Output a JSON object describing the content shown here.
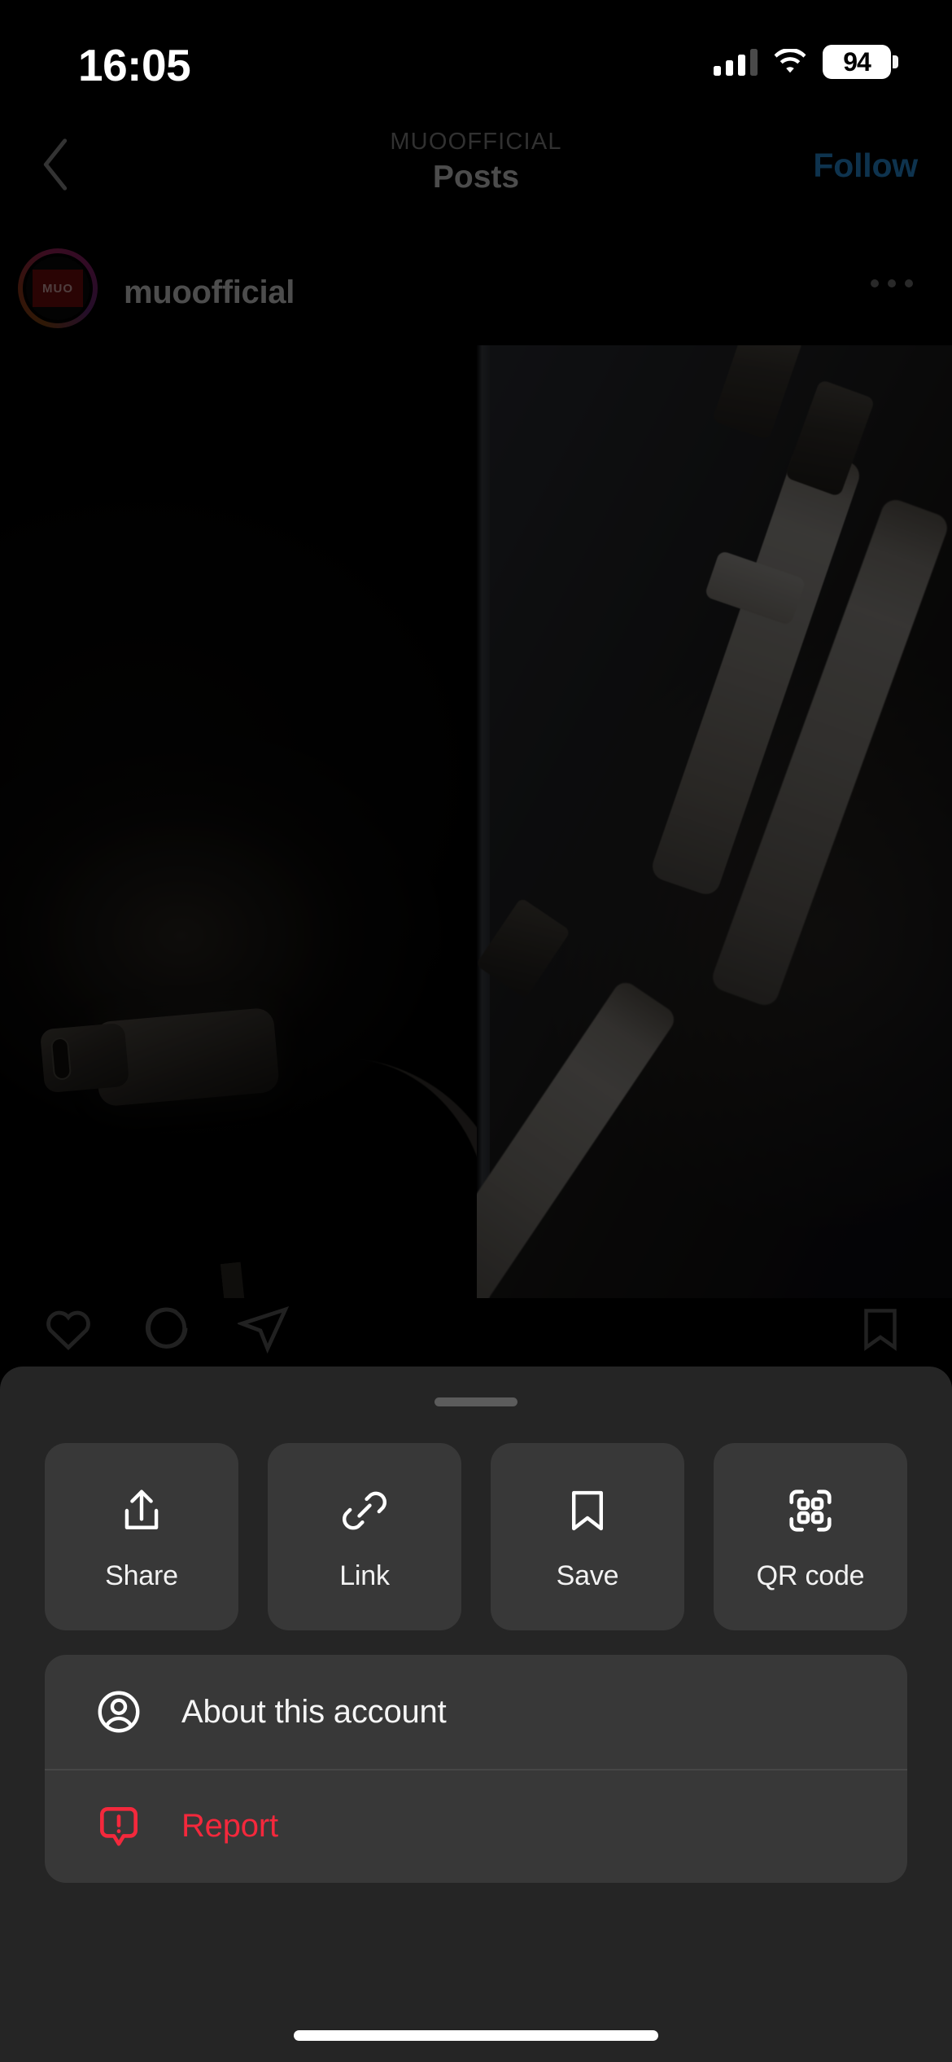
{
  "status_bar": {
    "time": "16:05",
    "battery_level": "94",
    "signal_icon": "cellular-signal-icon",
    "wifi_icon": "wifi-icon",
    "battery_icon": "battery-icon"
  },
  "nav": {
    "back_icon": "chevron-left-icon",
    "kicker": "MUOOFFICIAL",
    "title": "Posts",
    "follow_label": "Follow",
    "follow_color": "#1a5d8f"
  },
  "post_header": {
    "username": "muoofficial",
    "avatar_badge_text": "MUO",
    "more_icon": "more-options-icon"
  },
  "post_actions": {
    "like_icon": "heart-icon",
    "comment_icon": "comment-bubble-icon",
    "share_icon": "send-paperplane-icon",
    "save_icon": "bookmark-icon"
  },
  "media": {
    "left_caption": "usb-c-cable-photo",
    "right_caption": "lightning-cables-photo"
  },
  "sheet": {
    "grabber": "sheet-drag-handle",
    "tiles": [
      {
        "id": "share",
        "label": "Share",
        "icon": "share-upload-icon"
      },
      {
        "id": "link",
        "label": "Link",
        "icon": "chain-link-icon"
      },
      {
        "id": "save",
        "label": "Save",
        "icon": "bookmark-icon"
      },
      {
        "id": "qrcode",
        "label": "QR code",
        "icon": "qr-code-icon"
      }
    ],
    "menu": [
      {
        "id": "about",
        "label": "About this account",
        "icon": "person-circle-icon",
        "danger": false
      },
      {
        "id": "report",
        "label": "Report",
        "icon": "report-bubble-icon",
        "danger": true
      }
    ],
    "background_color": "#252525",
    "tile_color": "#383838",
    "danger_color": "#f4283c"
  },
  "home_indicator": "home-indicator"
}
